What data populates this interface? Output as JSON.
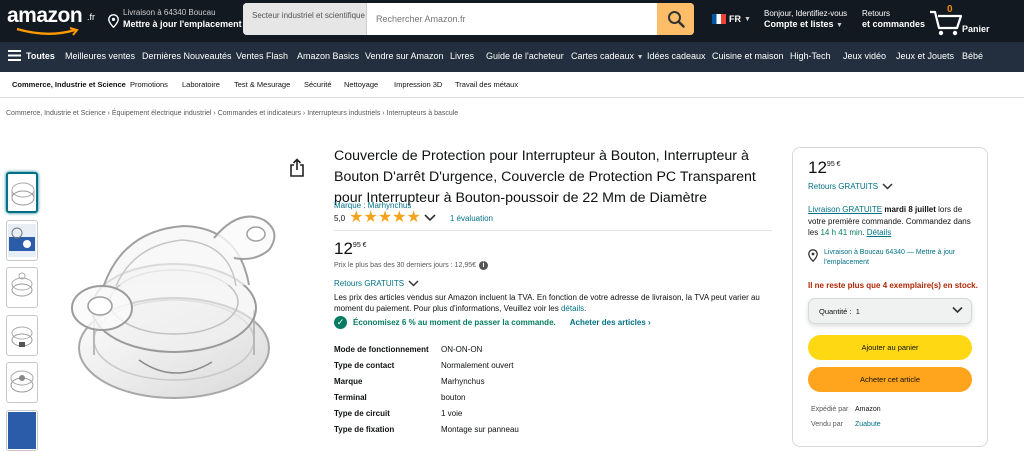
{
  "header": {
    "logo_text": "amazon",
    "logo_suffix": ".fr",
    "deliver_line1": "Livraison à 64340 Boucau",
    "deliver_line2": "Mettre à jour l'emplacement",
    "search_category": "Secteur industriel et scientifique",
    "search_placeholder": "Rechercher Amazon.fr",
    "language": "FR",
    "account_line1": "Bonjour, Identifiez-vous",
    "account_line2": "Compte et listes",
    "returns_line1": "Retours",
    "returns_line2": "et commandes",
    "cart_count": "0",
    "cart_label": "Panier"
  },
  "nav": {
    "all": "Toutes",
    "items": [
      "Meilleures ventes",
      "Dernières Nouveautés",
      "Ventes Flash",
      "Amazon Basics",
      "Vendre sur Amazon",
      "Livres",
      "Guide de l'acheteur",
      "Cartes cadeaux",
      "Idées cadeaux",
      "Cuisine et maison",
      "High-Tech",
      "Jeux vidéo",
      "Jeux et Jouets",
      "Bébé"
    ]
  },
  "subnav": {
    "items": [
      "Commerce, Industrie et Science",
      "Promotions",
      "Laboratoire",
      "Test & Mesurage",
      "Sécurité",
      "Nettoyage",
      "Impression 3D",
      "Travail des métaux"
    ]
  },
  "breadcrumb": [
    "Commerce, Industrie et Science",
    "Équipement électrique industriel",
    "Commandes et indicateurs",
    "Interrupteurs industriels",
    "Interrupteurs à bascule"
  ],
  "product": {
    "title": "Couvercle de Protection pour Interrupteur à Bouton, Interrupteur à Bouton D'arrêt D'urgence, Couvercle de Protection PC Transparent pour Interrupteur à Bouton-poussoir de 22 Mm de Diamètre",
    "brand": "Marque : Marhynchus",
    "rating_value": "5,0",
    "stars": 5,
    "rating_count": "1 évaluation",
    "price_whole": "12",
    "price_fraction": "95",
    "price_currency": "€",
    "lowest_price": "Prix le plus bas des 30 derniers jours : 12,95€",
    "free_returns": "Retours GRATUITS",
    "tva_text": "Les prix des articles vendus sur Amazon incluent la TVA. En fonction de votre adresse de livraison, la TVA peut varier au moment du paiement. Pour plus d'informations, Veuillez voir les",
    "tva_link": "détails",
    "promo_text": "Économisez 6 % au moment de passer la commande.",
    "promo_link": "Acheter des articles",
    "specs": [
      {
        "k": "Mode de fonctionnement",
        "v": "ON-ON-ON"
      },
      {
        "k": "Type de contact",
        "v": "Normalement ouvert"
      },
      {
        "k": "Marque",
        "v": "Marhynchus"
      },
      {
        "k": "Terminal",
        "v": "bouton"
      },
      {
        "k": "Type de circuit",
        "v": "1 voie"
      },
      {
        "k": "Type de fixation",
        "v": "Montage sur panneau"
      }
    ]
  },
  "buybox": {
    "price_whole": "12",
    "price_fraction": "95",
    "price_currency": "€",
    "free_returns": "Retours GRATUITS",
    "delivery_link": "Livraison GRATUITE",
    "delivery_date": "mardi 8 juillet",
    "delivery_rest": "lors de votre première commande. Commandez dans les",
    "countdown": "14 h 41 min",
    "details": "Détails",
    "location": "Livraison à Boucau 64340 — Mettre à jour l'emplacement",
    "stock": "Il ne reste plus que 4 exemplaire(s) en stock.",
    "qty_label": "Quantité :",
    "qty_value": "1",
    "add_to_cart": "Ajouter au panier",
    "buy_now": "Acheter cet article",
    "shipped_by_label": "Expédié par",
    "shipped_by": "Amazon",
    "sold_by_label": "Vendu par",
    "sold_by": "Zuabute"
  }
}
